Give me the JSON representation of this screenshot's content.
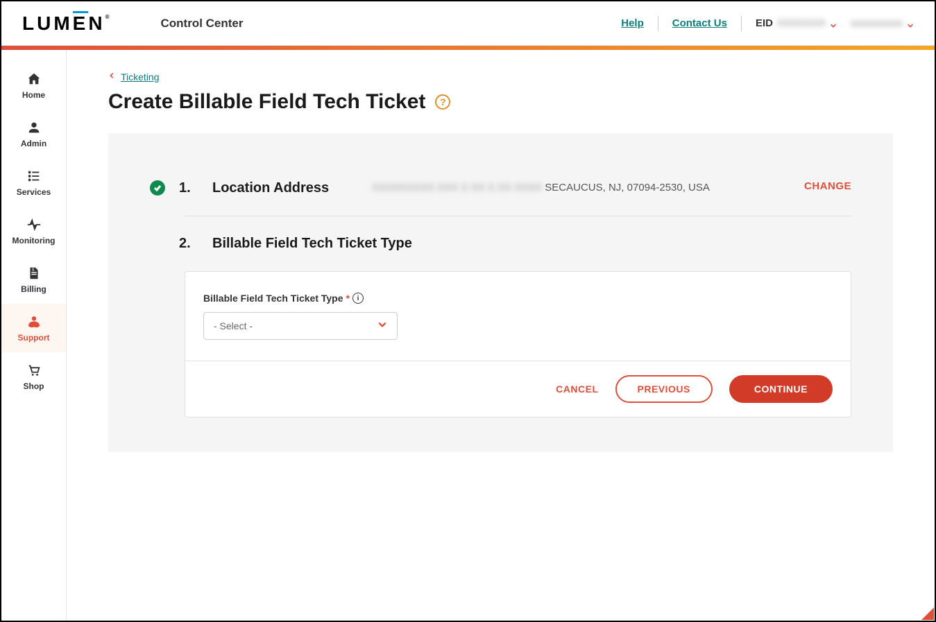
{
  "header": {
    "logo_text": "LUM",
    "logo_e": "E",
    "logo_n": "N",
    "app_title": "Control Center",
    "help_label": "Help",
    "contact_label": "Contact Us",
    "eid_label": "EID",
    "eid_value": "XXXXXXX",
    "user_value": "xxxxxxxxxx"
  },
  "sidebar": {
    "items": [
      {
        "label": "Home"
      },
      {
        "label": "Admin"
      },
      {
        "label": "Services"
      },
      {
        "label": "Monitoring"
      },
      {
        "label": "Billing"
      },
      {
        "label": "Support"
      },
      {
        "label": "Shop"
      }
    ]
  },
  "breadcrumb": {
    "link": "Ticketing"
  },
  "page": {
    "title": "Create Billable Field Tech Ticket"
  },
  "step1": {
    "number": "1.",
    "title": "Location Address",
    "address_hidden": "XXXXXXXXX XXX X XX X XX XXXX",
    "address_visible": " SECAUCUS, NJ, 07094-2530, USA",
    "change_label": "CHANGE"
  },
  "step2": {
    "number": "2.",
    "title": "Billable Field Tech Ticket Type",
    "field_label": "Billable Field Tech Ticket Type",
    "select_placeholder": "- Select -"
  },
  "actions": {
    "cancel": "CANCEL",
    "previous": "PREVIOUS",
    "continue": "CONTINUE"
  }
}
